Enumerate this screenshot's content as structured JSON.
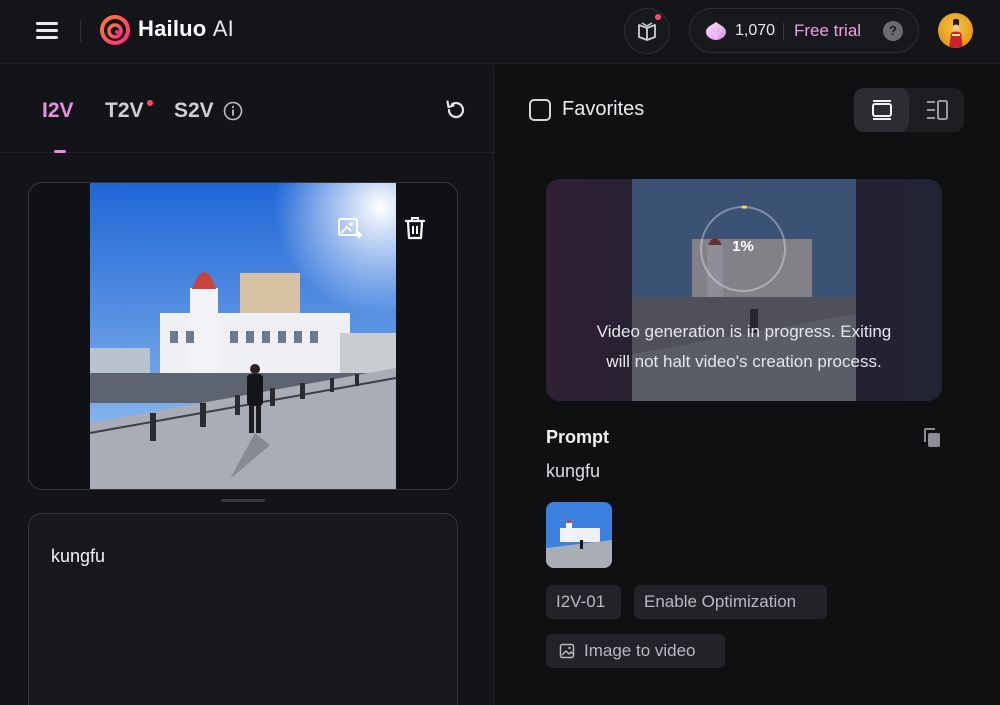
{
  "header": {
    "brand_bold": "Hailuo",
    "brand_light": "AI",
    "credits": "1,070",
    "free_trial": "Free trial",
    "help": "?",
    "icons": [
      "menu-icon",
      "hailuo-logo-icon",
      "book-icon",
      "gem-icon",
      "help-icon"
    ]
  },
  "left": {
    "tabs": [
      {
        "label": "I2V",
        "active": true
      },
      {
        "label": "T2V",
        "active": false
      },
      {
        "label": "S2V",
        "active": false
      }
    ],
    "prompt_text": "kungfu"
  },
  "right": {
    "favorites_label": "Favorites",
    "progress": "1%",
    "progress_fraction": 0.01,
    "message_line1": "Video generation is in progress. Exiting",
    "message_line2": "will not halt video's creation process.",
    "prompt_heading": "Prompt",
    "prompt_value": "kungfu",
    "tags": {
      "model": "I2V-01",
      "optimization": "Enable Optimization",
      "mode": "Image to video"
    }
  },
  "colors": {
    "accent_pink": "#e98ee0",
    "free_trial": "#f09fe0",
    "notification_red": "#ff4d5e",
    "background": "#0f1012"
  }
}
